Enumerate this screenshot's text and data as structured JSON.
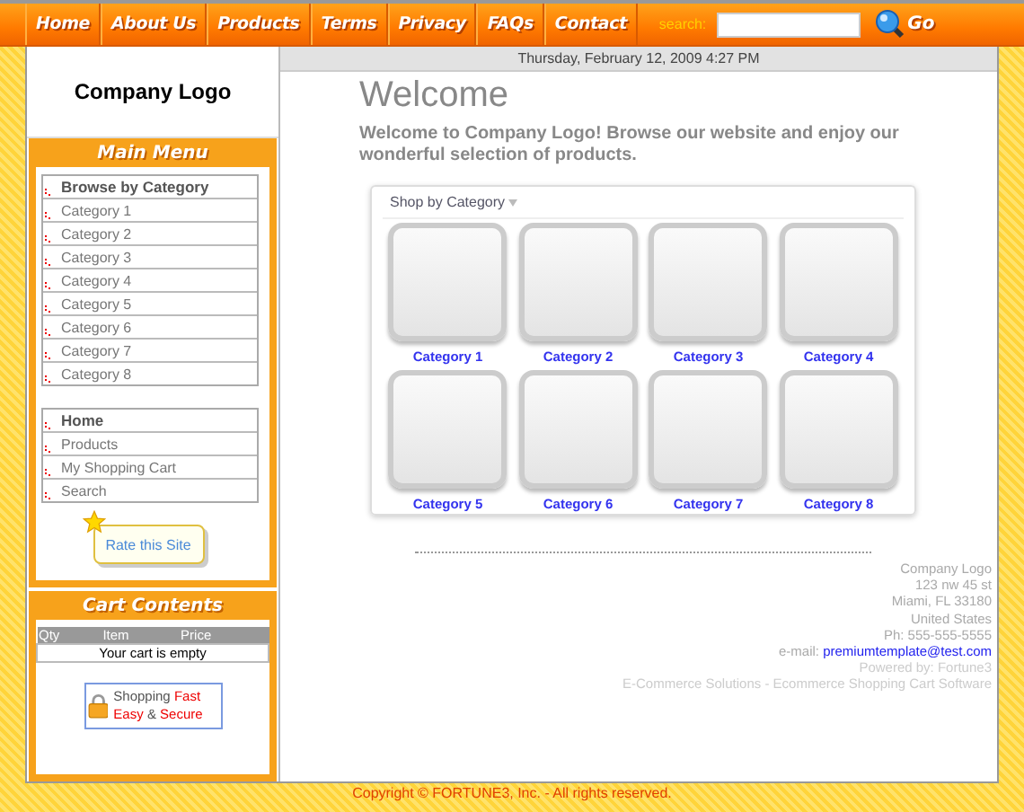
{
  "nav": {
    "items": [
      {
        "label": "Home"
      },
      {
        "label": "About Us"
      },
      {
        "label": "Products"
      },
      {
        "label": "Terms"
      },
      {
        "label": "Privacy"
      },
      {
        "label": "FAQs"
      },
      {
        "label": "Contact"
      }
    ],
    "search_label": "search:",
    "go_button": "Go"
  },
  "sidebar": {
    "logo": "Company Logo",
    "main_menu_title": "Main Menu",
    "menus": [
      {
        "items": [
          {
            "label": "Browse by Category",
            "kind": "header"
          },
          {
            "label": "Category 1",
            "kind": "link"
          },
          {
            "label": "Category 2",
            "kind": "link"
          },
          {
            "label": "Category 3",
            "kind": "link"
          },
          {
            "label": "Category 4",
            "kind": "link"
          },
          {
            "label": "Category 5",
            "kind": "link"
          },
          {
            "label": "Category 6",
            "kind": "link"
          },
          {
            "label": "Category 7",
            "kind": "link"
          },
          {
            "label": "Category 8",
            "kind": "link"
          }
        ]
      },
      {
        "items": [
          {
            "label": "Home",
            "kind": "header"
          },
          {
            "label": "Products",
            "kind": "link"
          },
          {
            "label": "My Shopping Cart",
            "kind": "link"
          },
          {
            "label": "Search",
            "kind": "link"
          }
        ]
      }
    ],
    "rate_button": "Rate this Site",
    "cart": {
      "title": "Cart Contents",
      "columns": [
        "Qty",
        "Item",
        "Price"
      ],
      "empty_message": "Your cart is empty"
    },
    "secure_badge": [
      {
        "text": "Shopping",
        "highlight": false
      },
      {
        "text": "Fast",
        "highlight": true
      },
      {
        "text": "Easy",
        "highlight": true
      },
      {
        "text": "&",
        "highlight": false
      },
      {
        "text": "Secure",
        "highlight": true
      }
    ]
  },
  "main": {
    "date": "Thursday, February 12, 2009 4:27 PM",
    "title": "Welcome",
    "intro": "Welcome to  Company Logo! Browse our website and enjoy our wonderful selection of products.",
    "shop": {
      "title": "Shop by Category",
      "categories": [
        "Category 1",
        "Category 2",
        "Category 3",
        "Category 4",
        "Category 5",
        "Category 6",
        "Category 7",
        "Category 8"
      ]
    },
    "footer": {
      "lines": [
        "Company Logo",
        "123 nw 45 st",
        "Miami, FL 33180",
        "United States",
        "Ph: 555-555-5555"
      ],
      "email_label": "e-mail:",
      "email": "premiumtemplate@test.com",
      "powered_by": "Powered by: Fortune3",
      "tagline": "E-Commerce Solutions - Ecommerce Shopping Cart Software"
    }
  },
  "copyright": "Copyright © FORTUNE3, Inc. - All rights reserved."
}
